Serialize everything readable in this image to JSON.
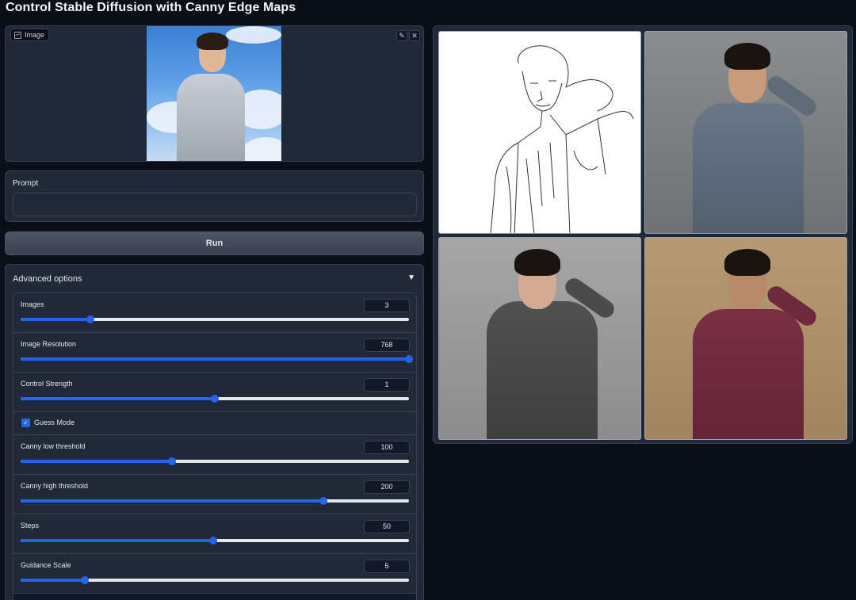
{
  "title": "Control Stable Diffusion with Canny Edge Maps",
  "image_input": {
    "label": "Image",
    "edit_icon": "pencil-icon",
    "clear_icon": "close-icon"
  },
  "prompt": {
    "label": "Prompt",
    "value": "",
    "placeholder": ""
  },
  "run_button": "Run",
  "advanced": {
    "label": "Advanced options",
    "toggle_icon": "▼",
    "sliders": [
      {
        "label": "Images",
        "value": "3",
        "fraction": 0.18
      },
      {
        "label": "Image Resolution",
        "value": "768",
        "fraction": 1.0
      },
      {
        "label": "Control Strength",
        "value": "1",
        "fraction": 0.5
      },
      {
        "label": "Canny low threshold",
        "value": "100",
        "fraction": 0.39
      },
      {
        "label": "Canny high threshold",
        "value": "200",
        "fraction": 0.78
      },
      {
        "label": "Steps",
        "value": "50",
        "fraction": 0.495
      },
      {
        "label": "Guidance Scale",
        "value": "5",
        "fraction": 0.165
      }
    ],
    "guess_mode": {
      "label": "Guess Mode",
      "checked": true
    }
  },
  "gallery": {
    "items": [
      "canny-edge-map",
      "generated-gray-shirt",
      "generated-dark-shirt",
      "generated-maroon-shirt"
    ]
  },
  "colors": {
    "background": "#0b0f19",
    "panel": "#1f2937",
    "accent": "#2563eb",
    "border": "#374151"
  }
}
